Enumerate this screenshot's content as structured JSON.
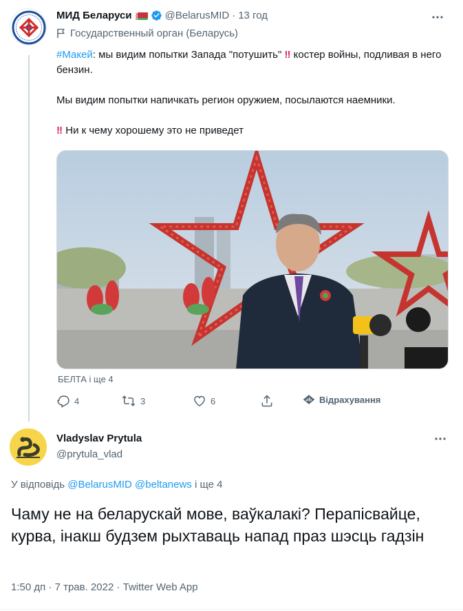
{
  "tweet1": {
    "author_name": "МИД Беларуси",
    "handle": "@BelarusMID",
    "time": "13 год",
    "label": "Государственный орган (Беларусь)",
    "text": {
      "hashtag": "#Макей",
      "line1_a": ": мы видим попытки Запада \"потушить\" ",
      "line1_b": " костер войны, подливая в него бензин.",
      "para2": "Мы видим попытки напичкать регион оружием, посылаются наемники.",
      "para3": " Ни к чему хорошему это не приведет",
      "emphasis_glyph": "‼"
    },
    "media_caption": "БЕЛТА і ще 4",
    "actions": {
      "replies": "4",
      "retweets": "3",
      "likes": "6",
      "analytics_label": "Відрахування"
    }
  },
  "tweet2": {
    "author_name": "Vladyslav Prytula",
    "handle": "@prytula_vlad",
    "reply_prefix": "У відповідь ",
    "reply_to_1": "@BelarusMID",
    "reply_to_2": "@beltanews",
    "reply_suffix": " і ще 4",
    "text": "Чаму не на беларускай мове, ваўкалакі? Перапісвайце, курва, інакш будзем рыхтаваць напад праз шэсць гадзін",
    "meta": "1:50 дп · 7 трав. 2022 · Twitter Web App"
  },
  "icons": {
    "more": "more-horizontal-icon",
    "verified": "verified-badge-icon",
    "flag": "belarus-flag-icon",
    "gov": "flag-outline-icon",
    "reply": "reply-icon",
    "retweet": "retweet-icon",
    "like": "like-icon",
    "share": "share-icon",
    "analytics": "analytics-icon"
  },
  "colors": {
    "accent": "#1d9bf0",
    "secondary_text": "#536471",
    "emphasis_red": "#e0245e"
  }
}
